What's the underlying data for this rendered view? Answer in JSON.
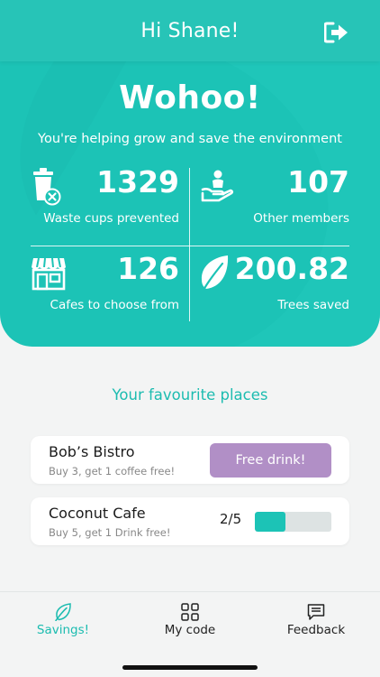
{
  "header": {
    "title": "Hi Shane!",
    "logout_icon": "logout-icon"
  },
  "hero": {
    "headline": "Wohoo!",
    "subtitle": "You're helping grow and save the environment",
    "stats": [
      {
        "value": "1329",
        "label": "Waste cups prevented",
        "icon": "cup-waste-icon"
      },
      {
        "value": "107",
        "label": "Other members",
        "icon": "members-icon"
      },
      {
        "value": "126",
        "label": "Cafes to choose from",
        "icon": "cafe-store-icon"
      },
      {
        "value": "200.82",
        "label": "Trees saved",
        "icon": "leaf-icon"
      }
    ]
  },
  "favourites": {
    "title": "Your favourite places",
    "places": [
      {
        "name": "Bob’s Bistro",
        "offer": "Buy 3, get 1 coffee free!",
        "action_label": "Free drink!"
      },
      {
        "name": "Coconut Cafe",
        "offer": "Buy 5, get 1 Drink free!",
        "progress_text": "2/5",
        "progress": 0.4
      }
    ]
  },
  "tabbar": {
    "tabs": [
      {
        "label": "Savings!",
        "icon": "leaf-outline-icon",
        "active": true
      },
      {
        "label": "My code",
        "icon": "grid-icon",
        "active": false
      },
      {
        "label": "Feedback",
        "icon": "message-icon",
        "active": false
      }
    ]
  },
  "colors": {
    "primary": "#1cc3b6",
    "accent_purple": "#b18fc6",
    "background": "#f3f4f4"
  }
}
